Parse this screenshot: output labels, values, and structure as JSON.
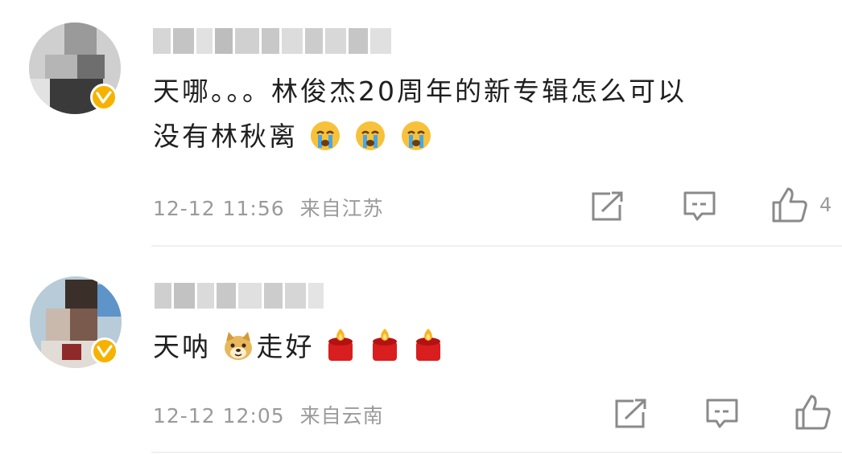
{
  "comments": [
    {
      "text_line1": "天哪。。。林俊杰20周年的新专辑怎么可以",
      "text_line2": "没有林秋离",
      "emojis": [
        "crying-face",
        "crying-face",
        "crying-face"
      ],
      "date": "12-12 11:56",
      "location": "来自江苏",
      "like_count": "4"
    },
    {
      "text_a": "天呐",
      "text_b": "走好",
      "emojis_inline": [
        "doge-face"
      ],
      "emojis_trailing": [
        "candle",
        "candle",
        "candle"
      ],
      "date": "12-12 12:05",
      "location": "来自云南",
      "like_count": ""
    }
  ],
  "colors": {
    "verified_badge": "#f5b300",
    "meta_text": "#9a9a9a",
    "icon": "#8a8a8a"
  }
}
